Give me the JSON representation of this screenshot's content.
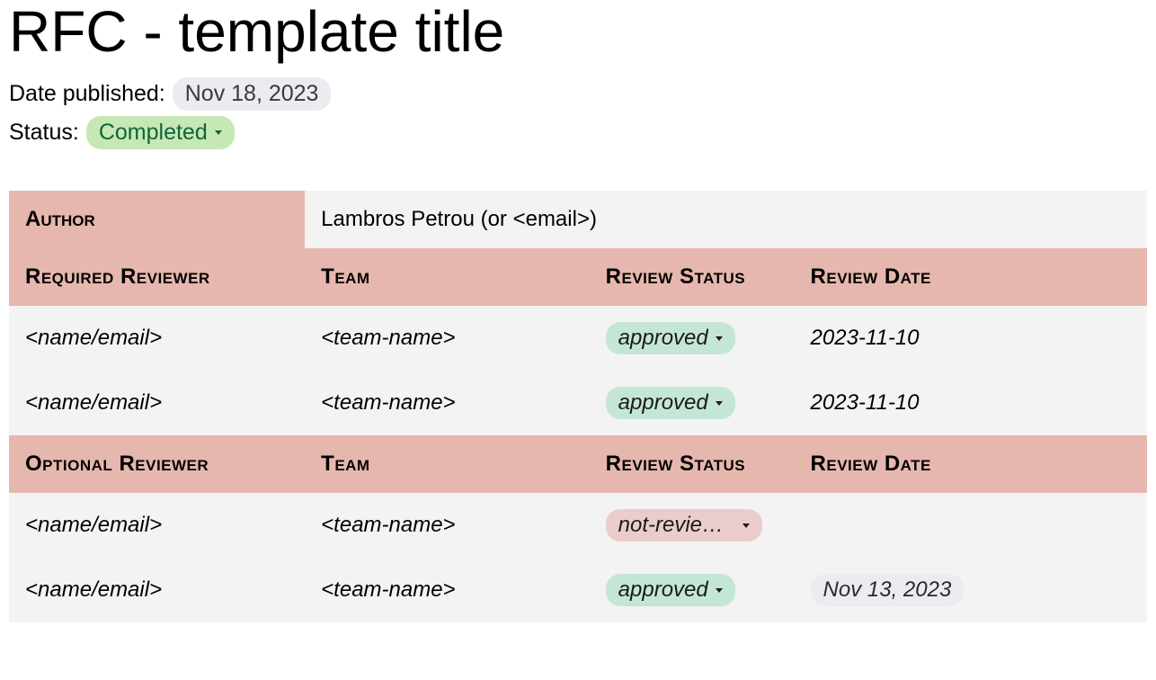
{
  "title": "RFC - template title",
  "meta": {
    "date_label": "Date published:",
    "date_value": "Nov 18, 2023",
    "status_label": "Status:",
    "status_value": "Completed"
  },
  "author_row": {
    "label": "Author",
    "value": "Lambros Petrou (or <email>)"
  },
  "required_header": {
    "c0": "Required Reviewer",
    "c1": "Team",
    "c2": "Review Status",
    "c3": "Review Date"
  },
  "required_rows": [
    {
      "name": "<name/email>",
      "team": "<team-name>",
      "status": "approved",
      "status_kind": "approved",
      "date": "2023-11-10",
      "date_pill": false
    },
    {
      "name": "<name/email>",
      "team": "<team-name>",
      "status": "approved",
      "status_kind": "approved",
      "date": "2023-11-10",
      "date_pill": false
    }
  ],
  "optional_header": {
    "c0": "Optional Reviewer",
    "c1": "Team",
    "c2": "Review Status",
    "c3": "Review Date"
  },
  "optional_rows": [
    {
      "name": "<name/email>",
      "team": "<team-name>",
      "status": "not-reviewed",
      "status_kind": "notrev",
      "date": "",
      "date_pill": false
    },
    {
      "name": "<name/email>",
      "team": "<team-name>",
      "status": "approved",
      "status_kind": "approved",
      "date": "Nov 13, 2023",
      "date_pill": true
    }
  ]
}
